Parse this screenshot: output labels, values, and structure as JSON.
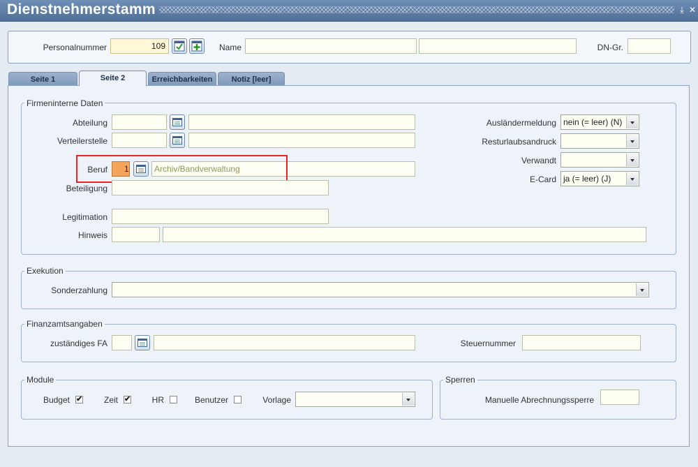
{
  "window": {
    "title": "Dienstnehmerstamm"
  },
  "header": {
    "personalnummer_label": "Personalnummer",
    "personalnummer_value": "109",
    "name_label": "Name",
    "name_first": "",
    "name_last": "",
    "dn_gr_label": "DN-Gr.",
    "dn_gr_value": ""
  },
  "tabs": [
    {
      "label": "Seite 1"
    },
    {
      "label": "Seite 2"
    },
    {
      "label": "Erreichbarkeiten"
    },
    {
      "label": "Notiz [leer]"
    }
  ],
  "firmeninterne": {
    "title": "Firmeninterne Daten",
    "abteilung_label": "Abteilung",
    "verteilerstelle_label": "Verteilerstelle",
    "beruf_label": "Beruf",
    "beruf_code": "1",
    "beruf_text": "Archiv/Bandverwaltung",
    "beteiligung_label": "Beteiligung",
    "legitimation_label": "Legitimation",
    "hinweis_label": "Hinweis",
    "auslaender_label": "Ausländermeldung",
    "auslaender_value": "nein (= leer) (N)",
    "resturlaub_label": "Resturlaubsandruck",
    "resturlaub_value": "",
    "verwandt_label": "Verwandt",
    "verwandt_value": "",
    "ecard_label": "E-Card",
    "ecard_value": "ja (= leer) (J)"
  },
  "exekution": {
    "title": "Exekution",
    "sonderzahlung_label": "Sonderzahlung",
    "sonderzahlung_value": ""
  },
  "finanzamt": {
    "title": "Finanzamtsangaben",
    "fa_label": "zuständiges FA",
    "steuernummer_label": "Steuernummer"
  },
  "module": {
    "title": "Module",
    "budget_label": "Budget",
    "budget_checked": "✔",
    "zeit_label": "Zeit",
    "zeit_checked": "✔",
    "hr_label": "HR",
    "benutzer_label": "Benutzer",
    "vorlage_label": "Vorlage",
    "vorlage_value": ""
  },
  "sperren": {
    "title": "Sperren",
    "manuelle_label": "Manuelle Abrechnungssperre",
    "manuelle_value": ""
  },
  "colors": {
    "titlebar": "#5a7aa3",
    "highlight": "#e22222",
    "active_field": "#f4a55a"
  }
}
